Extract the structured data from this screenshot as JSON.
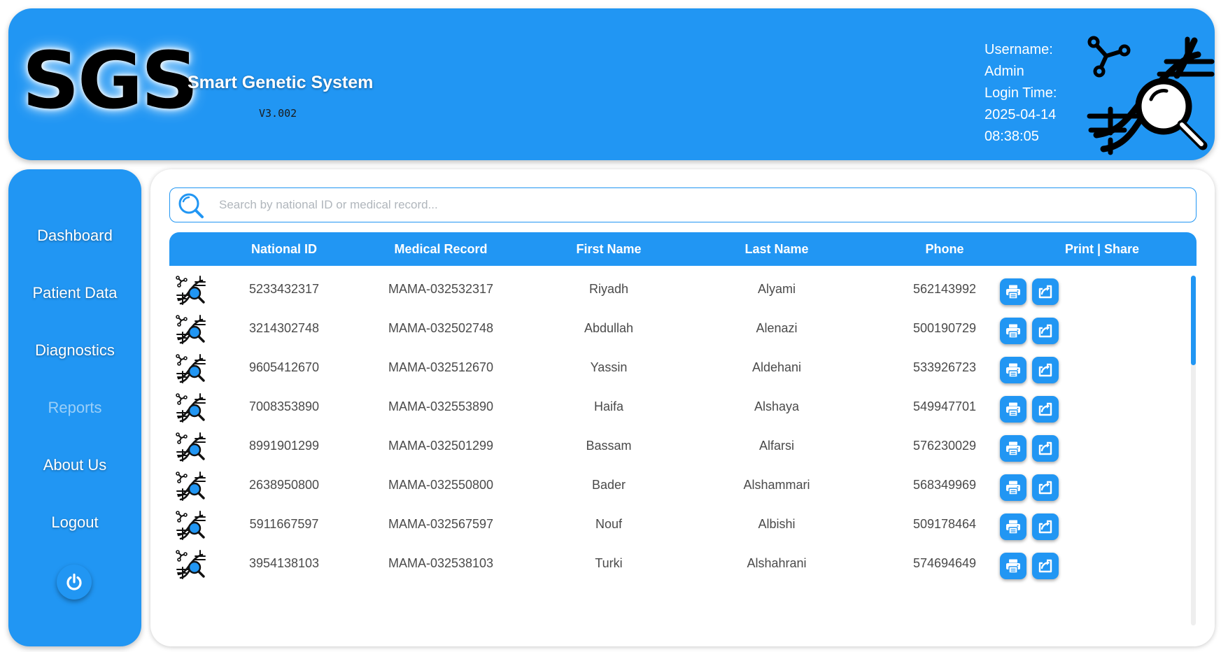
{
  "header": {
    "logo": "SGS",
    "title": "Smart Genetic System",
    "version": "V3.002",
    "username_label": "Username:",
    "username": "Admin",
    "login_time_label": "Login Time:",
    "login_date": "2025-04-14",
    "login_time": "08:38:05",
    "icon": "dna-search-icon"
  },
  "sidebar": {
    "items": [
      {
        "label": "Dashboard",
        "enabled": true
      },
      {
        "label": "Patient Data",
        "enabled": true
      },
      {
        "label": "Diagnostics",
        "enabled": true
      },
      {
        "label": "Reports",
        "enabled": false
      },
      {
        "label": "About Us",
        "enabled": true
      },
      {
        "label": "Logout",
        "enabled": true
      }
    ],
    "power_icon": "power-icon"
  },
  "search": {
    "placeholder": "Search by national ID or medical record...",
    "value": ""
  },
  "table": {
    "columns": [
      "National ID",
      "Medical Record",
      "First Name",
      "Last Name",
      "Phone",
      "Print | Share"
    ],
    "rows": [
      {
        "national_id": "5233432317",
        "medical_record": "MAMA-032532317",
        "first_name": "Riyadh",
        "last_name": "Alyami",
        "phone": "562143992"
      },
      {
        "national_id": "3214302748",
        "medical_record": "MAMA-032502748",
        "first_name": "Abdullah",
        "last_name": "Alenazi",
        "phone": "500190729"
      },
      {
        "national_id": "9605412670",
        "medical_record": "MAMA-032512670",
        "first_name": "Yassin",
        "last_name": "Aldehani",
        "phone": "533926723"
      },
      {
        "national_id": "7008353890",
        "medical_record": "MAMA-032553890",
        "first_name": "Haifa",
        "last_name": "Alshaya",
        "phone": "549947701"
      },
      {
        "national_id": "8991901299",
        "medical_record": "MAMA-032501299",
        "first_name": "Bassam",
        "last_name": "Alfarsi",
        "phone": "576230029"
      },
      {
        "national_id": "2638950800",
        "medical_record": "MAMA-032550800",
        "first_name": "Bader",
        "last_name": "Alshammari",
        "phone": "568349969"
      },
      {
        "national_id": "5911667597",
        "medical_record": "MAMA-032567597",
        "first_name": "Nouf",
        "last_name": "Albishi",
        "phone": "509178464"
      },
      {
        "national_id": "3954138103",
        "medical_record": "MAMA-032538103",
        "first_name": "Turki",
        "last_name": "Alshahrani",
        "phone": "574694649"
      }
    ]
  },
  "colors": {
    "primary": "#2196f3",
    "disabled_text": "#9bcff7",
    "body_text": "#4a4a4a"
  }
}
